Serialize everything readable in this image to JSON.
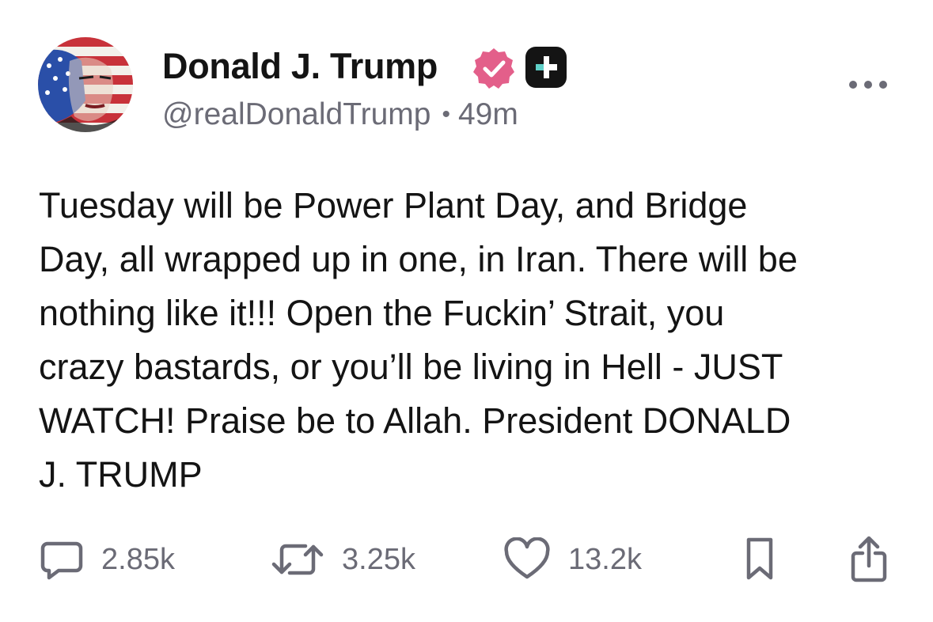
{
  "post": {
    "author": {
      "display_name": "Donald J. Trump",
      "handle": "@realDonaldTrump",
      "time_ago": "49m",
      "separator": "•",
      "verified_badge": "verified-check-icon",
      "plus_badge": "plus-badge-icon"
    },
    "body_lines": [
      "Tuesday will be Power Plant Day, and Bridge",
      "Day, all wrapped up in one, in Iran. There will be",
      "nothing like it!!! Open the Fuckin’ Strait, you",
      "crazy bastards, or you’ll be living in Hell - JUST",
      "WATCH! Praise be to Allah. President DONALD",
      "J. TRUMP"
    ],
    "actions": {
      "replies": "2.85k",
      "retruths": "3.25k",
      "likes": "13.2k"
    }
  },
  "icons": {
    "more": "ellipsis-icon",
    "reply": "reply-bubble-icon",
    "retruth": "retruth-arrows-icon",
    "like": "heart-icon",
    "bookmark": "bookmark-icon",
    "share": "share-icon"
  },
  "colors": {
    "text_primary": "#141414",
    "text_secondary": "#6b6b76",
    "verified_badge": "#e35f8a",
    "plus_badge": "#141414",
    "plus_accent": "#5fd0c8"
  }
}
